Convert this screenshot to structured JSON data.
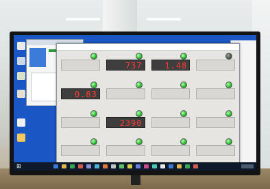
{
  "app": {
    "title": "",
    "meters": [
      {
        "label": "",
        "lamp": "on",
        "display_on": false,
        "value": ""
      },
      {
        "label": "",
        "lamp": "on",
        "display_on": true,
        "value": "737"
      },
      {
        "label": "",
        "lamp": "on",
        "display_on": true,
        "value": "1.48"
      },
      {
        "label": "",
        "lamp": "off",
        "display_on": false,
        "value": ""
      },
      {
        "label": "",
        "lamp": "on",
        "display_on": true,
        "value": "0.83"
      },
      {
        "label": "",
        "lamp": "on",
        "display_on": false,
        "value": ""
      },
      {
        "label": "",
        "lamp": "on",
        "display_on": false,
        "value": ""
      },
      {
        "label": "",
        "lamp": "on",
        "display_on": false,
        "value": ""
      },
      {
        "label": "",
        "lamp": "on",
        "display_on": false,
        "value": ""
      },
      {
        "label": "",
        "lamp": "on",
        "display_on": true,
        "value": "2390"
      },
      {
        "label": "",
        "lamp": "on",
        "display_on": false,
        "value": ""
      },
      {
        "label": "",
        "lamp": "on",
        "display_on": false,
        "value": ""
      },
      {
        "label": "",
        "lamp": "on",
        "display_on": false,
        "value": ""
      },
      {
        "label": "",
        "lamp": "on",
        "display_on": false,
        "value": ""
      },
      {
        "label": "",
        "lamp": "on",
        "display_on": false,
        "value": ""
      },
      {
        "label": "",
        "lamp": "on",
        "display_on": false,
        "value": ""
      }
    ]
  },
  "taskbar": {
    "start_symbol": "⊞"
  },
  "colors": {
    "desktop": "#1a56c4",
    "led_digits": "#ff3a32",
    "lamp_on": "#2fbf34"
  }
}
